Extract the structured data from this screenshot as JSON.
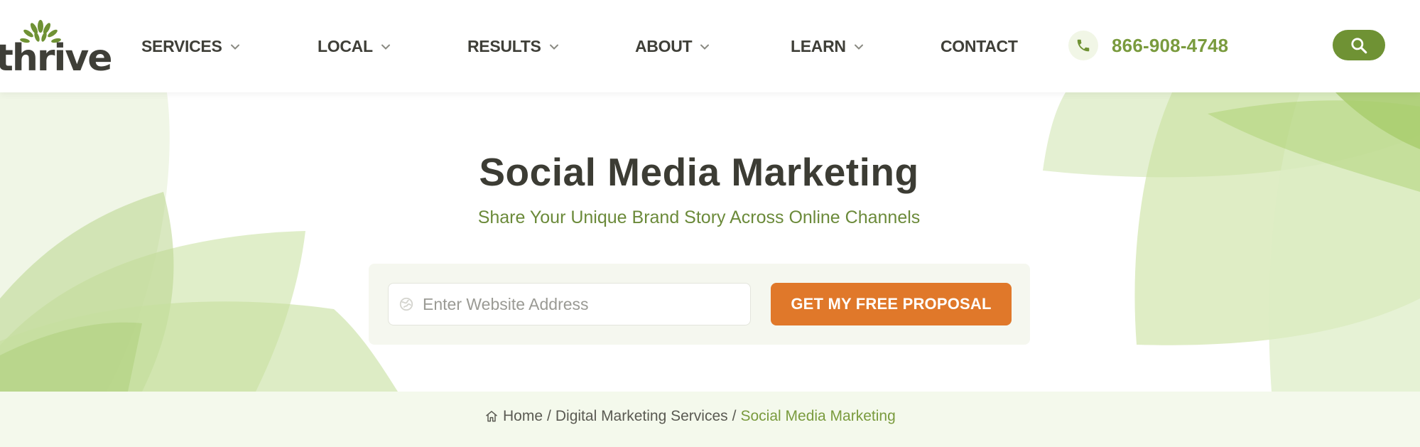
{
  "brand": {
    "logo_text": "thrive",
    "accent_color": "#6f9234",
    "cta_color": "#e0782a"
  },
  "nav": {
    "items": [
      {
        "label": "SERVICES",
        "dropdown": true
      },
      {
        "label": "LOCAL",
        "dropdown": true
      },
      {
        "label": "RESULTS",
        "dropdown": true
      },
      {
        "label": "ABOUT",
        "dropdown": true
      },
      {
        "label": "LEARN",
        "dropdown": true
      },
      {
        "label": "CONTACT",
        "dropdown": false
      }
    ],
    "phone": "866-908-4748",
    "phone_icon": "phone-icon",
    "search_icon": "search-icon"
  },
  "hero": {
    "title": "Social Media Marketing",
    "subtitle": "Share Your Unique Brand Story Across Online Channels",
    "form": {
      "url_placeholder": "Enter Website Address",
      "url_value": "",
      "url_icon": "globe-icon",
      "submit_label": "GET MY FREE PROPOSAL"
    }
  },
  "breadcrumb": {
    "home_icon": "home-icon",
    "items": [
      {
        "label": "Home"
      },
      {
        "label": "Digital Marketing Services"
      },
      {
        "label": "Social Media Marketing"
      }
    ],
    "separator": "/"
  }
}
